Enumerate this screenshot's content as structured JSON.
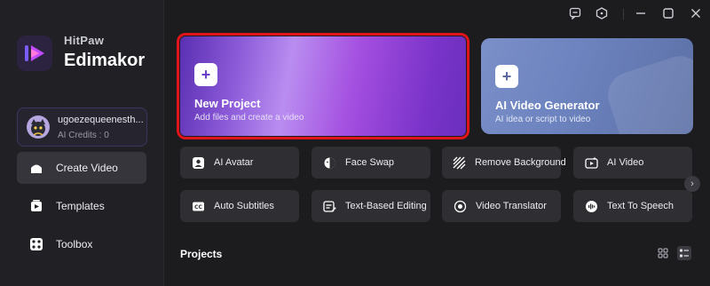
{
  "brand": {
    "top": "HitPaw",
    "main": "Edimakor"
  },
  "account": {
    "name": "ugoezequeenesth...",
    "credits": "AI Credits : 0"
  },
  "nav": [
    {
      "label": "Create Video",
      "icon": "home-icon",
      "active": true
    },
    {
      "label": "Templates",
      "icon": "templates-icon",
      "active": false
    },
    {
      "label": "Toolbox",
      "icon": "toolbox-icon",
      "active": false
    }
  ],
  "cards": {
    "new_project": {
      "title": "New Project",
      "subtitle": "Add files and create a video",
      "icon": "plus-icon"
    },
    "ai_video_generator": {
      "title": "AI Video Generator",
      "subtitle": "AI idea or script to video",
      "icon": "plus-icon"
    }
  },
  "tools": [
    {
      "label": "AI Avatar",
      "icon": "avatar-icon"
    },
    {
      "label": "Face Swap",
      "icon": "face-swap-icon"
    },
    {
      "label": "Remove Background",
      "icon": "remove-background-icon"
    },
    {
      "label": "AI Video",
      "icon": "ai-video-icon"
    },
    {
      "label": "Auto Subtitles",
      "icon": "subtitles-icon"
    },
    {
      "label": "Text-Based Editing",
      "icon": "text-editing-icon"
    },
    {
      "label": "Video Translator",
      "icon": "translator-icon"
    },
    {
      "label": "Text To Speech",
      "icon": "text-to-speech-icon"
    }
  ],
  "projects": {
    "title": "Projects"
  },
  "colors": {
    "highlight": "#e0151c",
    "accent": "#8b5ad8",
    "background": "#1c1c1f"
  }
}
